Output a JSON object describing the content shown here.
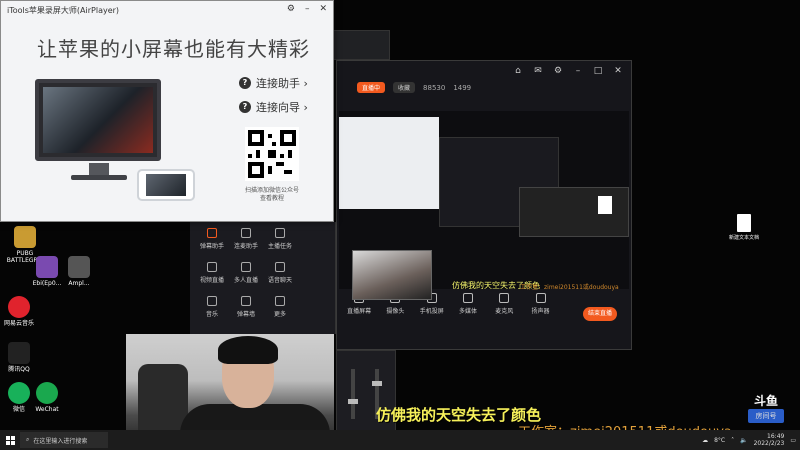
{
  "airplayer": {
    "window_title": "iTools苹果录屏大师(AirPlayer)",
    "slogan": "让苹果的小屏幕也能有大精彩",
    "connect_helper": "连接助手 ›",
    "connect_wizard": "连接向导 ›",
    "qr_caption_1": "扫描添加微信公众号",
    "qr_caption_2": "查看教程"
  },
  "stream_app": {
    "live_tag": "直播中",
    "secondary_tag": "收藏",
    "viewer_count": "88530",
    "likes": "1499",
    "toolbar": [
      {
        "label": "直播屏幕",
        "icon": "screen-icon"
      },
      {
        "label": "摄像头",
        "icon": "camera-icon"
      },
      {
        "label": "手机投屏",
        "icon": "phone-cast-icon"
      },
      {
        "label": "多媒体",
        "icon": "media-icon"
      },
      {
        "label": "麦克风",
        "icon": "mic-icon"
      },
      {
        "label": "扬声器",
        "icon": "speaker-icon"
      }
    ],
    "start_button": "结束直播",
    "small_subtitle": "仿佛我的天空失去了颜色",
    "small_studio": "工作室：zimei201511或doudouya"
  },
  "side_panel": {
    "tiles": [
      "弹幕助手",
      "连麦助手",
      "主播任务",
      "视频直播",
      "多人直播",
      "语音聊天",
      "音乐",
      "弹幕墙",
      "更多"
    ]
  },
  "desktop_icons": [
    {
      "label": "PUBG BATTLEGR...",
      "color": "#c99b32"
    },
    {
      "label": "Ebi(Ep0...",
      "color": "#7a4ab0"
    },
    {
      "label": "Ampl...",
      "color": "#555555"
    },
    {
      "label": "网易云音乐",
      "color": "#e0232d"
    },
    {
      "label": "腾讯QQ",
      "color": "#222222"
    },
    {
      "label": "微信",
      "color": "#18b15a"
    },
    {
      "label": "WeChat",
      "color": "#1aa84e"
    }
  ],
  "overlay": {
    "subtitle": "仿佛我的天空失去了颜色",
    "studio": "工作室：zimei201511或doudouya",
    "brand_line1": "斗鱼",
    "brand_line2": "房间号"
  },
  "desktop_file": "新建文本文档",
  "taskbar": {
    "search_placeholder": "在这里输入进行搜索",
    "temperature": "8°C",
    "time": "16:49",
    "date": "2022/2/23"
  }
}
